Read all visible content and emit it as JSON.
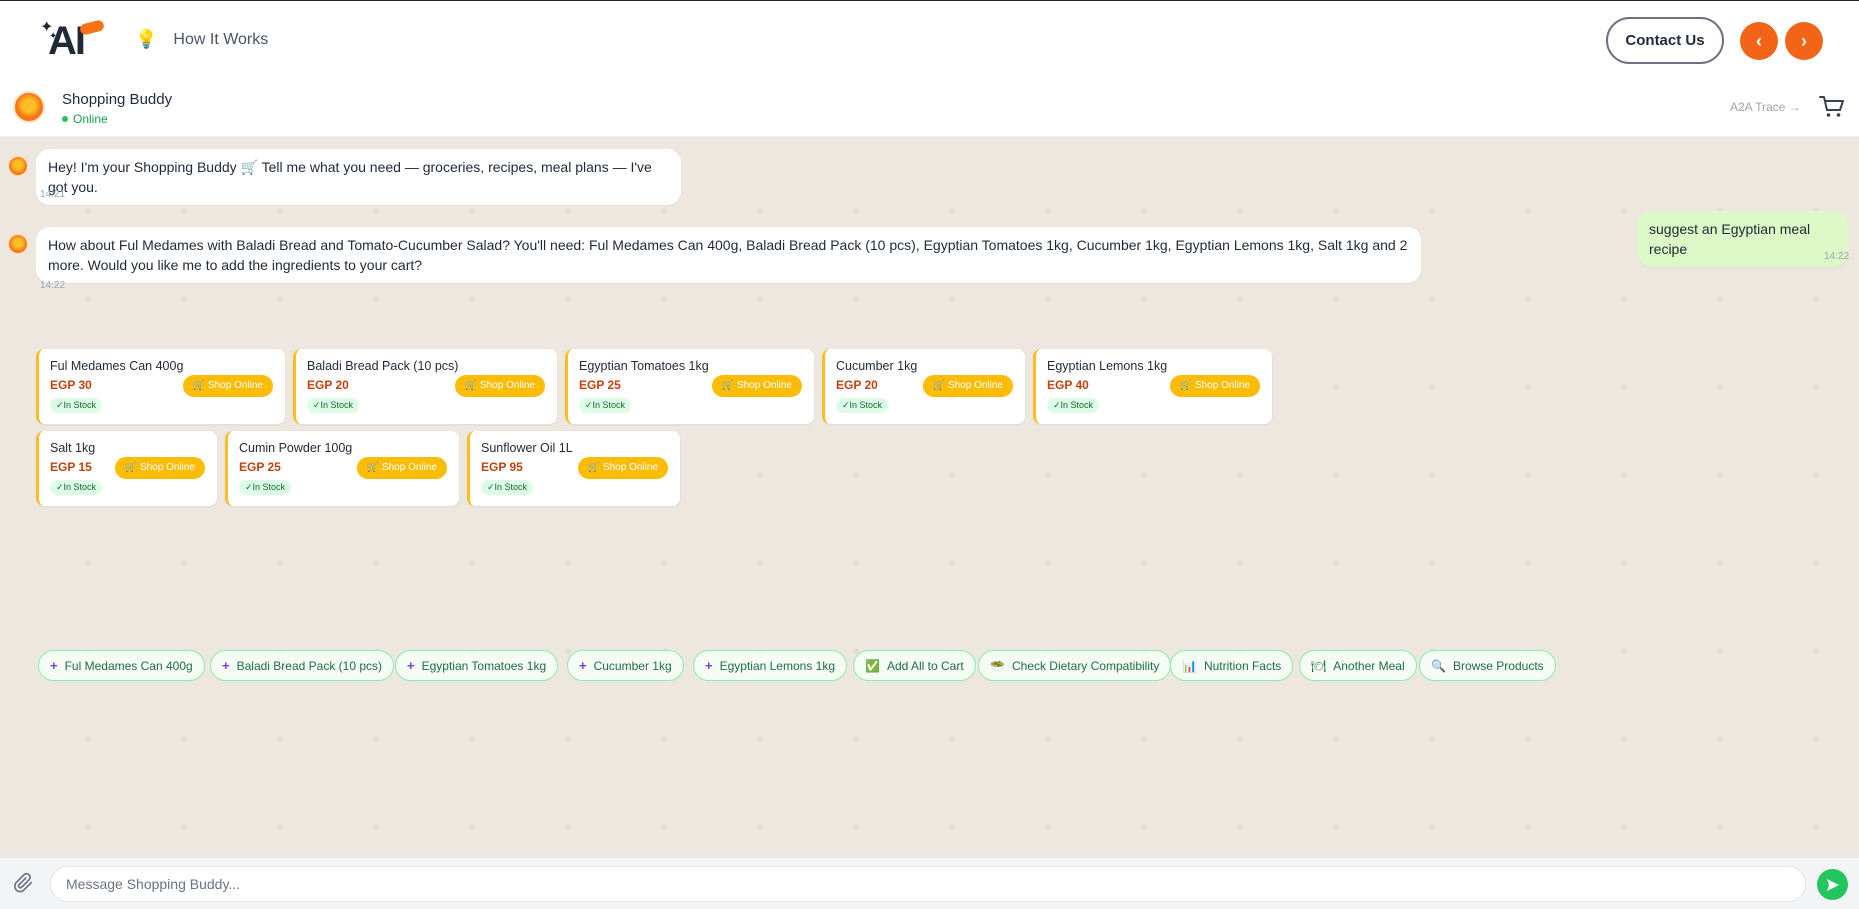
{
  "nav": {
    "logo_text": "AI",
    "how_it_works_label": "How It Works",
    "contact_label": "Contact Us",
    "prev_label": "‹",
    "next_label": "›",
    "accent_color": "#f26418"
  },
  "chat_header": {
    "bot_name": "Shopping Buddy",
    "status": "Online",
    "trace_label": "A2A Trace →"
  },
  "messages": [
    {
      "from": "bot",
      "text": "Hey! I'm your Shopping Buddy 🛒 Tell me what you need — groceries, recipes, meal plans — I've got you.",
      "time": "14:21"
    },
    {
      "from": "user",
      "text": "suggest an Egyptian meal recipe",
      "time": "14:22"
    },
    {
      "from": "bot",
      "text": "How about Ful Medames with Baladi Bread and Tomato-Cucumber Salad? You'll need: Ful Medames Can 400g, Baladi Bread Pack (10 pcs), Egyptian Tomatoes 1kg, Cucumber 1kg, Egyptian Lemons 1kg, Salt 1kg and 2 more. Would you like me to add the ingredients to your cart?",
      "time": "14:22"
    }
  ],
  "products": [
    {
      "name": "Ful Medames Can 400g",
      "price": "EGP 30",
      "stock": "✓In Stock",
      "shop_label": "🛒 Shop Online"
    },
    {
      "name": "Baladi Bread Pack (10 pcs)",
      "price": "EGP 20",
      "stock": "✓In Stock",
      "shop_label": "🛒 Shop Online"
    },
    {
      "name": "Egyptian Tomatoes 1kg",
      "price": "EGP 25",
      "stock": "✓In Stock",
      "shop_label": "🛒 Shop Online"
    },
    {
      "name": "Cucumber 1kg",
      "price": "EGP 20",
      "stock": "✓In Stock",
      "shop_label": "🛒 Shop Online"
    },
    {
      "name": "Egyptian Lemons 1kg",
      "price": "EGP 40",
      "stock": "✓In Stock",
      "shop_label": "🛒 Shop Online"
    },
    {
      "name": "Salt 1kg",
      "price": "EGP 15",
      "stock": "✓In Stock",
      "shop_label": "🛒 Shop Online"
    },
    {
      "name": "Cumin Powder 100g",
      "price": "EGP 25",
      "stock": "✓In Stock",
      "shop_label": "🛒 Shop Online"
    },
    {
      "name": "Sunflower Oil 1L",
      "price": "EGP 95",
      "stock": "✓In Stock",
      "shop_label": "🛒 Shop Online"
    }
  ],
  "chips": [
    {
      "icon": "plus-icon",
      "glyph": "+",
      "label": "Ful Medames Can 400g"
    },
    {
      "icon": "plus-icon",
      "glyph": "+",
      "label": "Baladi Bread Pack (10 pcs)"
    },
    {
      "icon": "plus-icon",
      "glyph": "+",
      "label": "Egyptian Tomatoes 1kg"
    },
    {
      "icon": "plus-icon",
      "glyph": "+",
      "label": "Cucumber 1kg"
    },
    {
      "icon": "plus-icon",
      "glyph": "+",
      "label": "Egyptian Lemons 1kg"
    },
    {
      "icon": "check-box-icon",
      "glyph": "✅",
      "label": "Add All to Cart"
    },
    {
      "icon": "salad-icon",
      "glyph": "🥗",
      "label": "Check Dietary Compatibility"
    },
    {
      "icon": "bar-chart-icon",
      "glyph": "📊",
      "label": "Nutrition Facts"
    },
    {
      "icon": "plate-icon",
      "glyph": "🍽",
      "label": "Another Meal"
    },
    {
      "icon": "magnifier-icon",
      "glyph": "🔍",
      "label": "Browse Products"
    }
  ],
  "composer": {
    "placeholder": "Message Shopping Buddy..."
  }
}
